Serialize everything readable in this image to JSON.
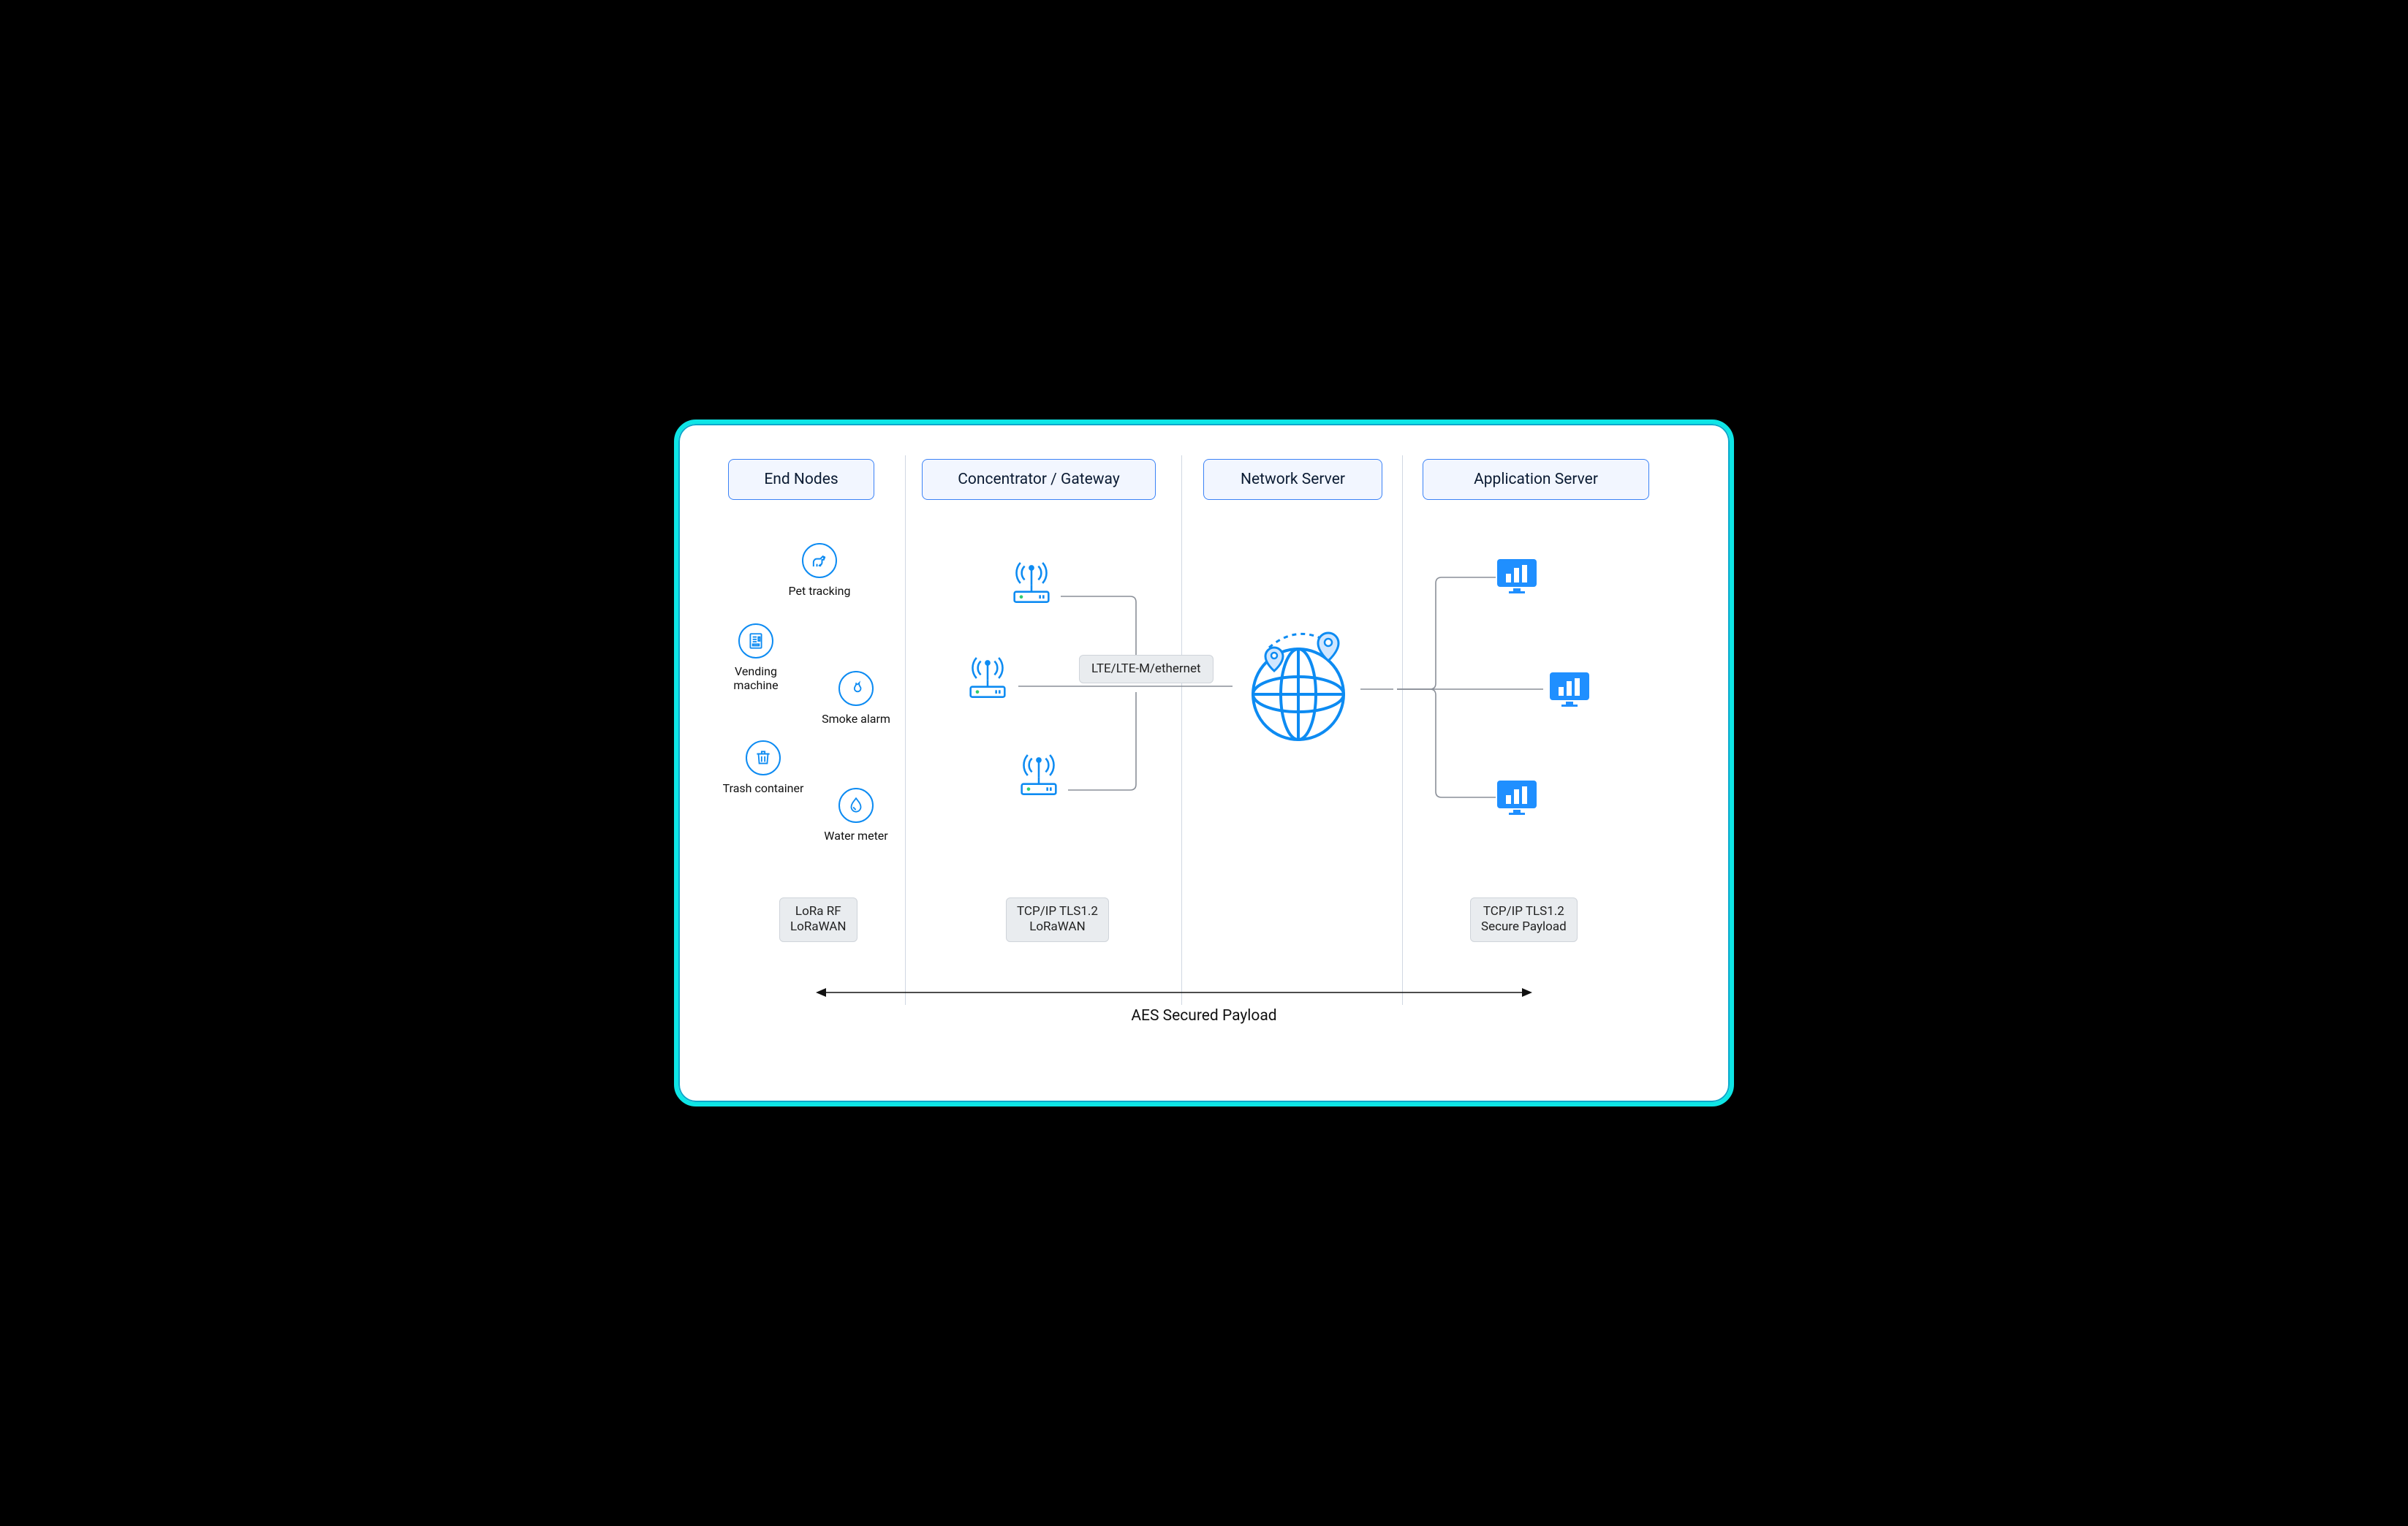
{
  "columns": {
    "end_nodes": "End Nodes",
    "gateway": "Concentrator / Gateway",
    "network_server": "Network Server",
    "app_server": "Application Server"
  },
  "end_nodes": {
    "pet": "Pet tracking",
    "vending": "Vending machine",
    "smoke": "Smoke alarm",
    "trash": "Trash container",
    "water": "Water meter"
  },
  "backhaul_label": "LTE/LTE-M/ethernet",
  "protocols": {
    "end_nodes": "LoRa RF\nLoRaWAN",
    "gateway": "TCP/IP TLS1.2\nLoRaWAN",
    "app_server": "TCP/IP TLS1.2\nSecure Payload"
  },
  "footer_arrow_label": "AES Secured Payload",
  "icons": {
    "pet": "dog-icon",
    "vending": "vending-icon",
    "smoke": "flame-icon",
    "trash": "trash-icon",
    "water": "droplet-icon",
    "gateway": "antenna-router-icon",
    "globe": "globe-location-icon",
    "monitor": "chart-monitor-icon"
  },
  "colors": {
    "accent_blue": "#0d8bf2",
    "icon_fill_blue": "#1f8fff",
    "frame_cyan": "#0ee6e6",
    "divider": "#d0d8e2",
    "header_bg": "#f2f6ff"
  }
}
